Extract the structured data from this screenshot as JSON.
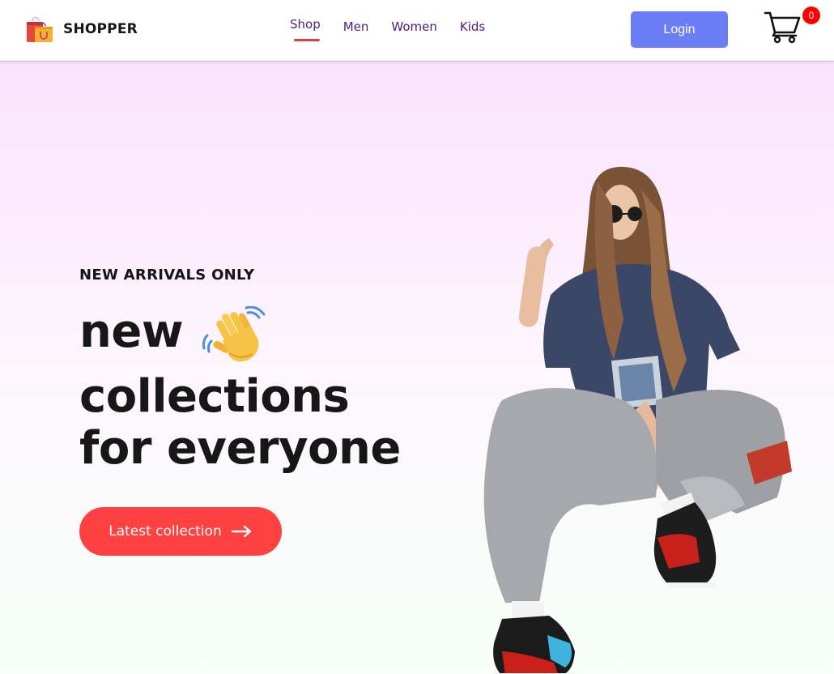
{
  "brand": {
    "name": "SHOPPER",
    "logo_icon": "shopping-bags-icon"
  },
  "nav": {
    "items": [
      {
        "label": "Shop",
        "active": true
      },
      {
        "label": "Men",
        "active": false
      },
      {
        "label": "Women",
        "active": false
      },
      {
        "label": "Kids",
        "active": false
      }
    ]
  },
  "header": {
    "login_label": "Login",
    "cart_icon": "cart-icon",
    "cart_count": "0"
  },
  "hero": {
    "kicker": "NEW ARRIVALS ONLY",
    "line1": "new",
    "line1_icon": "waving-hand-icon",
    "line2": "collections",
    "line3": "for everyone",
    "cta_label": "Latest collection",
    "cta_icon": "arrow-right-icon"
  },
  "colors": {
    "nav_text": "#4e1e7e",
    "active_underline": "#e43c3c",
    "login_bg": "#6a7ef5",
    "cta_bg": "#ff4141",
    "badge_bg": "#ff0000",
    "hero_gradient_top": "#fae2fd",
    "hero_gradient_bottom": "#f6fff8"
  }
}
